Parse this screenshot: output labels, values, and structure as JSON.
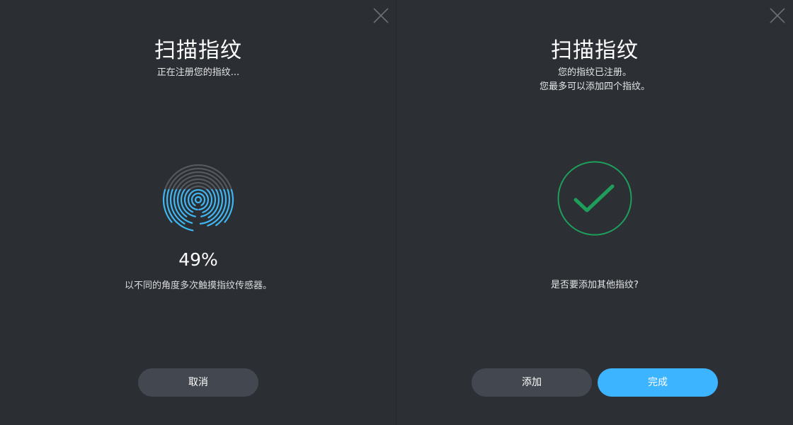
{
  "scan_panel": {
    "title": "扫描指纹",
    "subtitle": "正在注册您的指纹...",
    "progress_text": "49%",
    "progress": 49,
    "hint": "以不同的角度多次触摸指纹传感器。",
    "cancel_label": "取消",
    "close_icon": "close-icon",
    "fingerprint_icon": "fingerprint-icon"
  },
  "done_panel": {
    "title": "扫描指纹",
    "subtitle_line1": "您的指纹已注册。",
    "subtitle_line2": "您最多可以添加四个指纹。",
    "question": "是否要添加其他指纹?",
    "add_label": "添加",
    "done_label": "完成",
    "close_icon": "close-icon",
    "success_icon": "checkmark-circle-icon"
  },
  "colors": {
    "background": "#2b2e32",
    "accent_blue": "#3db4ff",
    "success_green": "#1e9e5a",
    "fingerprint_blue": "#3fb6f2",
    "fingerprint_gray": "#55595e",
    "button_gray": "#434850"
  }
}
